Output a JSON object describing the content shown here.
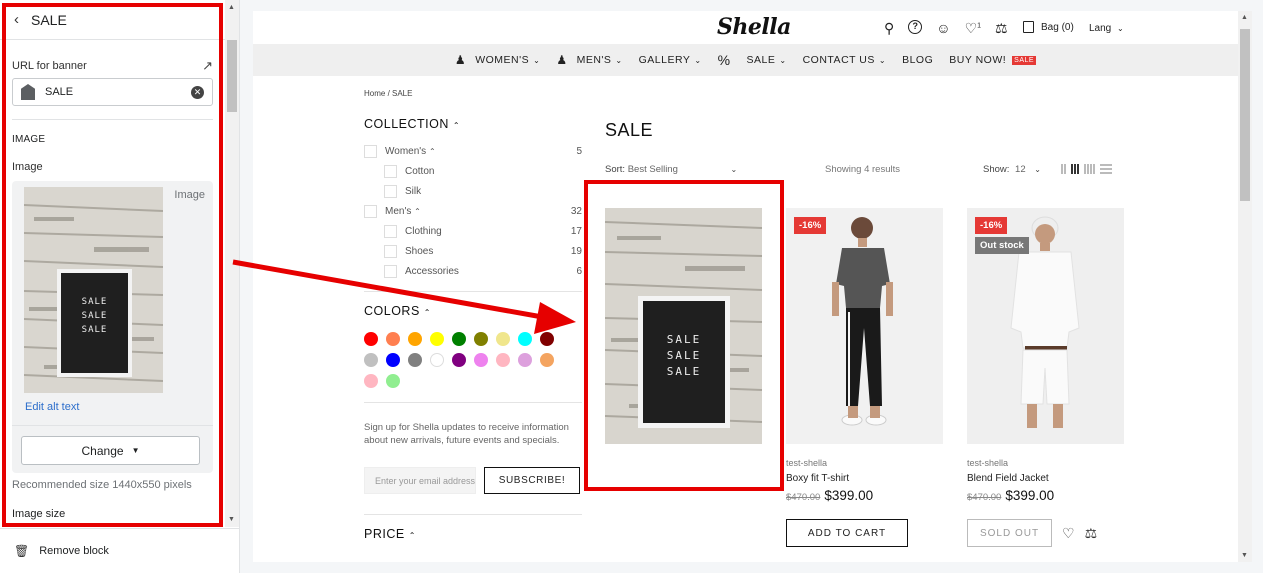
{
  "editor": {
    "title": "SALE",
    "url_label": "URL for banner",
    "url_value": "SALE",
    "section_heading": "IMAGE",
    "image_label": "Image",
    "image_card_label": "Image",
    "edit_alt": "Edit alt text",
    "change_label": "Change",
    "recommended": "Recommended size 1440x550 pixels",
    "image_size_label": "Image size",
    "remove_block": "Remove block",
    "board_text": [
      "SALE",
      "SALE",
      "SALE"
    ]
  },
  "store": {
    "logo": "Shella",
    "bag": "Bag (0)",
    "lang": "Lang",
    "wishlist_count": "1",
    "nav": [
      {
        "label": "WOMEN'S",
        "icon": "woman-icon",
        "chevron": true
      },
      {
        "label": "MEN'S",
        "icon": "man-icon",
        "chevron": true
      },
      {
        "label": "GALLERY",
        "icon": "",
        "chevron": true
      },
      {
        "label": "%",
        "icon": "",
        "chevron": false
      },
      {
        "label": "SALE",
        "icon": "",
        "chevron": true
      },
      {
        "label": "CONTACT US",
        "icon": "",
        "chevron": true
      },
      {
        "label": "BLOG",
        "icon": "",
        "chevron": false
      },
      {
        "label": "BUY NOW!",
        "icon": "",
        "chevron": false
      }
    ],
    "nav_badge": "SALE",
    "breadcrumb": "Home  /  SALE"
  },
  "filters": {
    "collection_title": "COLLECTION",
    "collections": [
      {
        "name": "Women's",
        "count": "5",
        "sub": false,
        "chevron": true
      },
      {
        "name": "Cotton",
        "count": "",
        "sub": true,
        "chevron": false
      },
      {
        "name": "Silk",
        "count": "",
        "sub": true,
        "chevron": false
      },
      {
        "name": "Men's",
        "count": "32",
        "sub": false,
        "chevron": true
      },
      {
        "name": "Clothing",
        "count": "17",
        "sub": true,
        "chevron": false
      },
      {
        "name": "Shoes",
        "count": "19",
        "sub": true,
        "chevron": false
      },
      {
        "name": "Accessories",
        "count": "6",
        "sub": true,
        "chevron": false
      }
    ],
    "colors_title": "COLORS",
    "colors": [
      "#ff0000",
      "#ff7f50",
      "#ffa500",
      "#ffff00",
      "#008000",
      "#808000",
      "#f0e68c",
      "#00ffff",
      "#800000",
      "#c0c0c0",
      "#0000ff",
      "#808080",
      "#ffffff",
      "#800080",
      "#ee82ee",
      "#ffb6c1",
      "#dda0dd",
      "#f4a460",
      "#ffb6c1",
      "#90ee90"
    ],
    "signup_text": "Sign up for Shella updates to receive information about new arrivals, future events and specials.",
    "email_placeholder": "Enter your email address",
    "subscribe": "SUBSCRIBE!",
    "price_title": "PRICE"
  },
  "listing": {
    "title": "SALE",
    "sort_label": "Sort:",
    "sort_value": "Best Selling",
    "showing": "Showing 4 results",
    "show_label": "Show:",
    "show_value": "12",
    "products": [
      {
        "vendor": "",
        "name": "",
        "old_price": "",
        "price": "",
        "badge": "",
        "stock": "",
        "action": ""
      },
      {
        "vendor": "test-shella",
        "name": "Boxy fit T-shirt",
        "old_price": "$470.00",
        "price": "$399.00",
        "badge": "-16%",
        "stock": "",
        "action": "ADD TO CART"
      },
      {
        "vendor": "test-shella",
        "name": "Blend Field Jacket",
        "old_price": "$470.00",
        "price": "$399.00",
        "badge": "-16%",
        "stock": "Out stock",
        "action": "SOLD OUT"
      }
    ]
  }
}
